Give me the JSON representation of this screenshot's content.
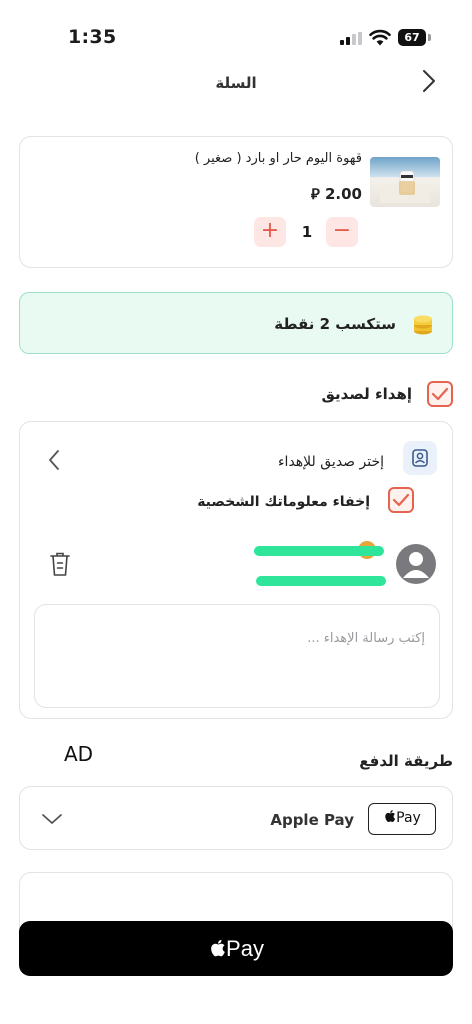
{
  "status_bar": {
    "time": "1:35",
    "battery": "67"
  },
  "header": {
    "title": "السلة"
  },
  "cart": {
    "items": [
      {
        "name": "قهوة اليوم حار او بارد ( صغير )",
        "price": "2.00 ⃁",
        "quantity": "1"
      }
    ]
  },
  "points": {
    "text": "ستكسب 2 نقطة"
  },
  "gift": {
    "label": "إهداء لصديق",
    "choose_friend": "إختر صديق للإهداء",
    "hide_info_label": "إخفاء معلوماتك الشخصية",
    "message_placeholder": "إكتب رسالة الإهداء ..."
  },
  "ad": {
    "label": "AD"
  },
  "payment": {
    "title": "طريقة الدفع",
    "method_label": "Apple Pay",
    "badge_text": "Pay"
  },
  "pay_button": {
    "label": "Pay"
  },
  "icons": {
    "back": "chevron-right-icon",
    "coin": "coin-stack-icon",
    "friend": "contact-card-icon",
    "trash": "trash-icon",
    "avatar": "user-avatar-icon",
    "dropdown": "chevron-down-icon",
    "apple": "apple-logo-icon"
  },
  "colors": {
    "accent": "#e4644f",
    "points_bg": "#e9faf2",
    "points_border": "#9fe0c7",
    "redaction": "#2ee59a",
    "pay_button": "#000000"
  }
}
